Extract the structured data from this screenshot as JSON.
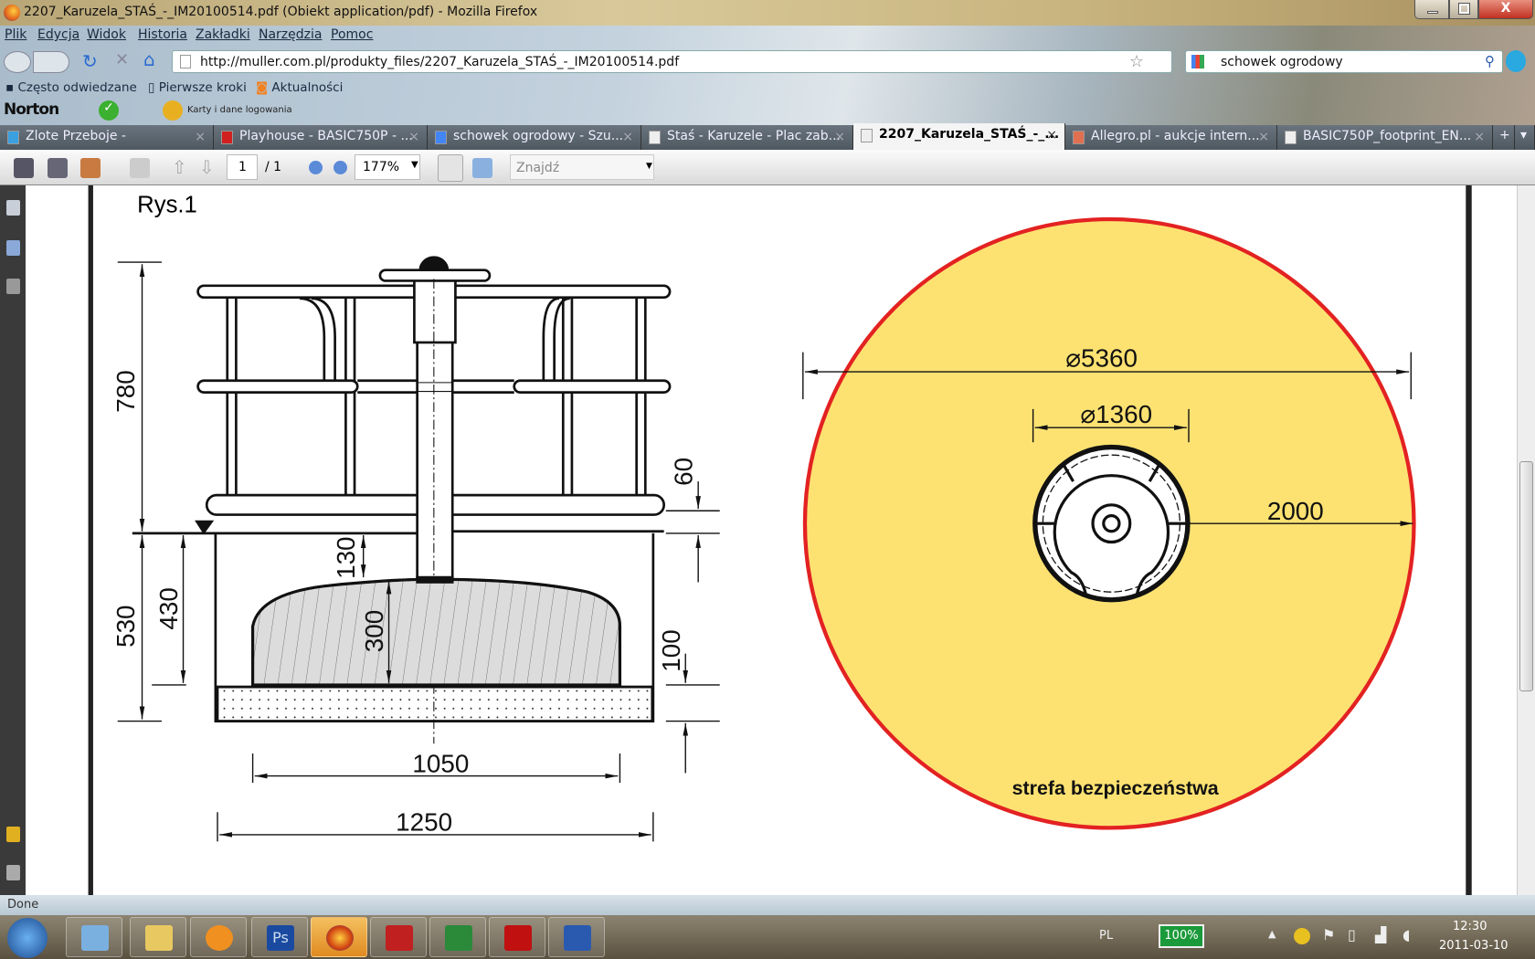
{
  "window": {
    "title": "2207_Karuzela_STAŚ_-_IM20100514.pdf (Obiekt application/pdf) - Mozilla Firefox"
  },
  "menu": [
    "Plik",
    "Edycja",
    "Widok",
    "Historia",
    "Zakładki",
    "Narzędzia",
    "Pomoc"
  ],
  "nav": {
    "url": "http://muller.com.pl/produkty_files/2207_Karuzela_STAŚ_-_IM20100514.pdf",
    "search": "schowek ogrodowy"
  },
  "bookmarks": [
    "Często odwiedzane",
    "Pierwsze kroki",
    "Aktualności"
  ],
  "norton": {
    "label": "Norton",
    "vault": "Karty i dane logowania"
  },
  "tabs": [
    {
      "label": "Zlote Przeboje -"
    },
    {
      "label": "Playhouse - BASIC750P - ..."
    },
    {
      "label": "schowek ogrodowy - Szu..."
    },
    {
      "label": "Staś - Karuzele - Plac zab..."
    },
    {
      "label": "2207_Karuzela_STAŚ_-_...",
      "active": true
    },
    {
      "label": "Allegro.pl - aukcje intern..."
    },
    {
      "label": "BASIC750P_footprint_EN..."
    }
  ],
  "pdf_toolbar": {
    "page": "1",
    "page_total": "/ 1",
    "zoom": "177%",
    "find_placeholder": "Znajdź"
  },
  "drawing": {
    "caption": "Rys.1",
    "dims": {
      "h780": "780",
      "h530": "530",
      "h430": "430",
      "h130": "130",
      "h300": "300",
      "h60": "60",
      "h100": "100",
      "w1050": "1050",
      "w1250": "1250",
      "d5360": "⌀5360",
      "d1360": "⌀1360",
      "r2000": "2000"
    },
    "zone_label": "strefa bezpieczeństwa",
    "colors": {
      "zone_fill": "#fde272",
      "zone_stroke": "#e32222"
    }
  },
  "status": "Done",
  "tray": {
    "lang": "PL",
    "battery": "100%",
    "time": "12:30",
    "date": "2011-03-10"
  }
}
